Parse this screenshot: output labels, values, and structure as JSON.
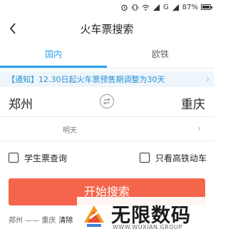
{
  "status_bar": {
    "battery_text": "87%",
    "network_text": "G"
  },
  "header": {
    "title": "火车票搜索"
  },
  "tabs": [
    {
      "label": "国内",
      "active": true
    },
    {
      "label": "欧铁",
      "active": false
    }
  ],
  "notice": {
    "text": "【通知】12.30日起火车票预售期调整为30天"
  },
  "route": {
    "from": "郑州",
    "to": "重庆"
  },
  "date": {
    "text": "明天"
  },
  "options": {
    "student_label": "学生票查询",
    "highspeed_label": "只看高铁动车"
  },
  "search_button": {
    "label": "开始搜索"
  },
  "history": {
    "route": "郑州 —— 重庆",
    "clear_partial": "清除"
  },
  "watermark": {
    "title": "无限数码",
    "url": "WWW.WUXIAN.GROUP"
  },
  "colors": {
    "accent": "#2aa4ee",
    "button": "#f4654b",
    "notice_bg": "#eef6fc"
  }
}
